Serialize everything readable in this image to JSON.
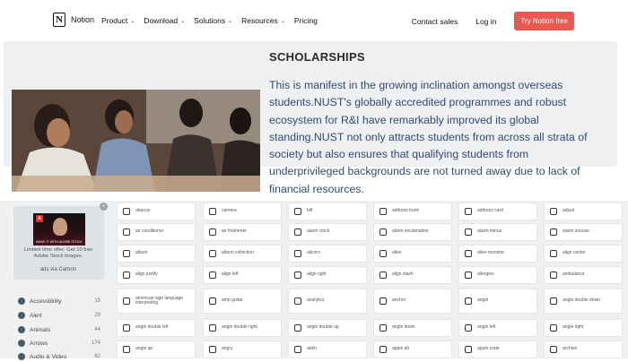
{
  "nav": {
    "brand": "Notion",
    "brand_logo": "N",
    "menu": [
      {
        "label": "Product",
        "dropdown": true
      },
      {
        "label": "Download",
        "dropdown": true
      },
      {
        "label": "Solutions",
        "dropdown": true
      },
      {
        "label": "Resources",
        "dropdown": true
      },
      {
        "label": "Pricing",
        "dropdown": false
      }
    ],
    "contact_sales": "Contact sales",
    "login": "Log in",
    "cta": "Try Notion free",
    "cta_color": "#e85a4f"
  },
  "hero": {
    "title": "SCHOLARSHIPS",
    "body": "This is manifest in the growing inclination amongst overseas students.NUST's globally accredited programmes and robust ecosystem for R&I have remarkably improved its global standing.NUST not only attracts students from across all strata of society but also ensures that qualifying students from underprivileged backgrounds are not turned away due to lack of financial resources.",
    "text_color": "#2f4a78"
  },
  "ad": {
    "close": "×",
    "thumb_logo": "A",
    "thumb_caption": "MAKE IT WITH ADOBE STOCK",
    "text": "Limited time offer: Get 10 free Adobe Stock images.",
    "via": "ads via Carbon"
  },
  "categories": [
    {
      "label": "Accessibility",
      "count": "15"
    },
    {
      "label": "Alert",
      "count": "29"
    },
    {
      "label": "Animals",
      "count": "44"
    },
    {
      "label": "Arrows",
      "count": "174"
    },
    {
      "label": "Audio & Video",
      "count": "62"
    }
  ],
  "icons": [
    [
      "abacus",
      "camera",
      "bill",
      "address book",
      "address card",
      "adjust"
    ],
    [
      "air conditioner",
      "air freshener",
      "alarm clock",
      "alarm exclamation",
      "alarm minus",
      "alarm snooze"
    ],
    [
      "album",
      "album collection",
      "alicorn",
      "alien",
      "alien monster",
      "align center"
    ],
    [
      "align justify",
      "align left",
      "align right",
      "align slash",
      "allergies",
      "ambulance"
    ],
    [
      "american sign language interpreting",
      "amp guitar",
      "analytics",
      "anchor",
      "angel",
      "angle double down"
    ],
    [
      "angle double left",
      "angle double right",
      "angle double up",
      "angle down",
      "angle left",
      "angle right"
    ],
    [
      "angle up",
      "angry",
      "ankh",
      "apple alt",
      "apple crate",
      "archive"
    ]
  ]
}
